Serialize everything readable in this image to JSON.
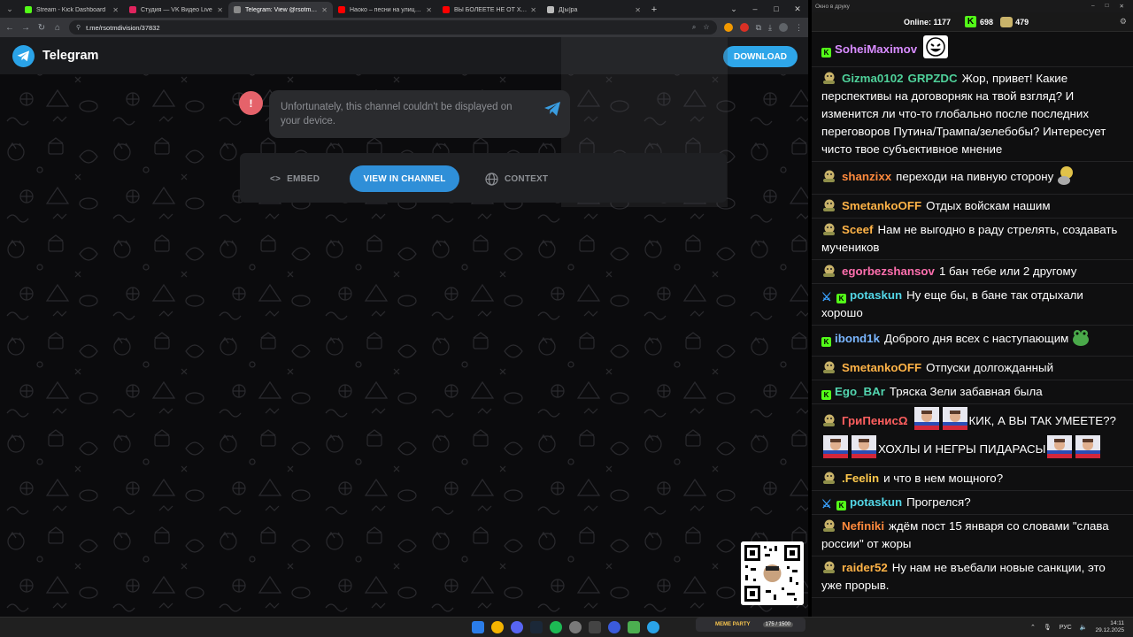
{
  "browser": {
    "tabs": [
      {
        "label": "Stream - Kick Dashboard",
        "color": "#53fc18",
        "active": false
      },
      {
        "label": "Студия — VK Видео Live",
        "color": "#e0245e",
        "active": false
      },
      {
        "label": "Telegram: View @rsotmdivision",
        "color": "#8a8a8a",
        "active": true
      },
      {
        "label": "Наоко – песни на улицах, арт",
        "color": "#ff0000",
        "active": false
      },
      {
        "label": "ВЫ БОЛЕЕТЕ НЕ ОТ ХОЛОДА",
        "color": "#ff0000",
        "active": false
      },
      {
        "label": "Д[ы]ра",
        "color": "#bbbbbb",
        "active": false
      }
    ],
    "url": "t.me/rsotmdivision/37832"
  },
  "telegram": {
    "brand": "Telegram",
    "download_label": "DOWNLOAD",
    "error_icon": "!",
    "error_message": "Unfortunately, this channel couldn't be displayed on your device.",
    "embed_label": "EMBED",
    "view_label": "VIEW IN CHANNEL",
    "context_label": "CONTEXT",
    "accent": "#2aa3e8"
  },
  "chat": {
    "window_title": "Окно в друку",
    "online_label": "Online:",
    "online_count": "1177",
    "kick_count": "698",
    "coin_count": "479",
    "messages": [
      {
        "user": "SoheiMaximov",
        "color": "#d88cff",
        "badge": "kick",
        "text": "",
        "emote": "smile"
      },
      {
        "user": "Gizma0102",
        "user2": "GRPZDC",
        "color": "#4fd19a",
        "badge": "avatar",
        "text": "Жор, привет! Какие перспективы на договорняк на твой взгляд? И изменится ли что-то глобально после последних переговоров Путина/Трампа/зелебобы? Интересует чисто твое субъективное мнение"
      },
      {
        "user": "shanzixx",
        "color": "#ff8a3d",
        "badge": "avatar",
        "text": "переходи на пивную сторону",
        "emote": "beer"
      },
      {
        "user": "SmetankoOFF",
        "color": "#ffb347",
        "badge": "avatar",
        "text": "Отдых войскам нашим"
      },
      {
        "user": "Sceef",
        "color": "#ffb347",
        "badge": "avatar",
        "text": "Нам не выгодно в раду стрелять, создавать мучеников"
      },
      {
        "user": "egorbezshansov",
        "color": "#ff6fae",
        "badge": "avatar",
        "text": "1 бан тебе или 2 другому"
      },
      {
        "user": "potaskun",
        "color": "#53d6e6",
        "badge": "sword-kick",
        "text": "Ну еще бы, в бане так отдыхали хорошо"
      },
      {
        "user": "ibond1k",
        "color": "#7ab6ff",
        "badge": "kick",
        "text": "Доброго дня всех с наступающим",
        "emote": "frog"
      },
      {
        "user": "SmetankoOFF",
        "color": "#ffb347",
        "badge": "avatar",
        "text": "Отпуски долгожданный"
      },
      {
        "user": "Ego_BAr",
        "color": "#53d6b0",
        "badge": "kick",
        "text": "Тряска Зели забавная была"
      },
      {
        "user": "ГриПенисΩ",
        "color": "#ff5f5f",
        "badge": "avatar",
        "text_parts": [
          "КИК, А ВЫ ТАК УМЕЕТЕ??",
          "ХОХЛЫ И НЕГРЫ ПИДАРАСЫ"
        ]
      },
      {
        "user": ".Feelin",
        "color": "#ffc94d",
        "badge": "avatar",
        "text": "и что в нем мощного?"
      },
      {
        "user": "potaskun",
        "color": "#53d6e6",
        "badge": "sword-kick",
        "text": "Прогрелся?"
      },
      {
        "user": "Nefiniki",
        "color": "#ff8a3d",
        "badge": "avatar",
        "text": "ждём пост 15 января со словами \"слава россии\" от жоры"
      },
      {
        "user": "raider52",
        "color": "#ffb347",
        "badge": "avatar",
        "text": "Ну нам не въебали новые санкции, это уже прорыв."
      }
    ]
  },
  "taskbar": {
    "meme_party_label": "MEME PARTY",
    "meme_party_count": "175 / 1500",
    "lang": "РУС",
    "time": "14:11",
    "date": "29.12.2025"
  }
}
